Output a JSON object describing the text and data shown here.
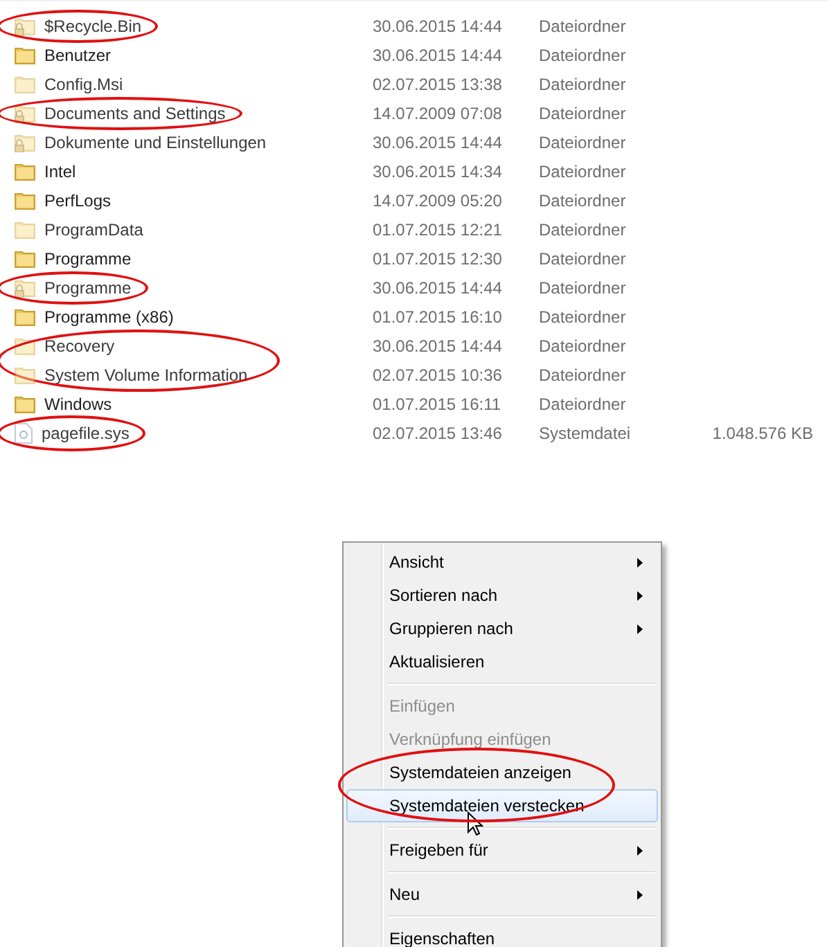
{
  "files": [
    {
      "name": "$Recycle.Bin",
      "date": "30.06.2015 14:44",
      "type": "Dateiordner",
      "kind": "folder",
      "locked": true,
      "hidden": true,
      "circled": true
    },
    {
      "name": "Benutzer",
      "date": "30.06.2015 14:44",
      "type": "Dateiordner",
      "kind": "folder",
      "locked": false,
      "hidden": false,
      "circled": false
    },
    {
      "name": "Config.Msi",
      "date": "02.07.2015 13:38",
      "type": "Dateiordner",
      "kind": "folder",
      "locked": false,
      "hidden": true,
      "circled": false
    },
    {
      "name": "Documents and Settings",
      "date": "14.07.2009 07:08",
      "type": "Dateiordner",
      "kind": "folder",
      "locked": true,
      "hidden": true,
      "circled": true
    },
    {
      "name": "Dokumente und Einstellungen",
      "date": "30.06.2015 14:44",
      "type": "Dateiordner",
      "kind": "folder",
      "locked": true,
      "hidden": true,
      "circled": false
    },
    {
      "name": "Intel",
      "date": "30.06.2015 14:34",
      "type": "Dateiordner",
      "kind": "folder",
      "locked": false,
      "hidden": false,
      "circled": false
    },
    {
      "name": "PerfLogs",
      "date": "14.07.2009 05:20",
      "type": "Dateiordner",
      "kind": "folder",
      "locked": false,
      "hidden": false,
      "circled": false
    },
    {
      "name": "ProgramData",
      "date": "01.07.2015 12:21",
      "type": "Dateiordner",
      "kind": "folder",
      "locked": false,
      "hidden": true,
      "circled": false
    },
    {
      "name": "Programme",
      "date": "01.07.2015 12:30",
      "type": "Dateiordner",
      "kind": "folder",
      "locked": false,
      "hidden": false,
      "circled": false
    },
    {
      "name": "Programme",
      "date": "30.06.2015 14:44",
      "type": "Dateiordner",
      "kind": "folder",
      "locked": true,
      "hidden": true,
      "circled": true
    },
    {
      "name": "Programme (x86)",
      "date": "01.07.2015 16:10",
      "type": "Dateiordner",
      "kind": "folder",
      "locked": false,
      "hidden": false,
      "circled": false
    },
    {
      "name": "Recovery",
      "date": "30.06.2015 14:44",
      "type": "Dateiordner",
      "kind": "folder",
      "locked": false,
      "hidden": true,
      "circled": true
    },
    {
      "name": "System Volume Information",
      "date": "02.07.2015 10:36",
      "type": "Dateiordner",
      "kind": "folder",
      "locked": false,
      "hidden": true,
      "circled": true
    },
    {
      "name": "Windows",
      "date": "01.07.2015 16:11",
      "type": "Dateiordner",
      "kind": "folder",
      "locked": false,
      "hidden": false,
      "circled": false
    },
    {
      "name": "pagefile.sys",
      "date": "02.07.2015 13:46",
      "type": "Systemdatei",
      "size": "1.048.576 KB",
      "kind": "file",
      "locked": false,
      "hidden": true,
      "circled": true
    }
  ],
  "context_menu": {
    "groups": [
      [
        {
          "label": "Ansicht",
          "submenu": true,
          "disabled": false,
          "selected": false,
          "circled": false
        },
        {
          "label": "Sortieren nach",
          "submenu": true,
          "disabled": false,
          "selected": false,
          "circled": false
        },
        {
          "label": "Gruppieren nach",
          "submenu": true,
          "disabled": false,
          "selected": false,
          "circled": false
        },
        {
          "label": "Aktualisieren",
          "submenu": false,
          "disabled": false,
          "selected": false,
          "circled": false
        }
      ],
      [
        {
          "label": "Einfügen",
          "submenu": false,
          "disabled": true,
          "selected": false,
          "circled": false
        },
        {
          "label": "Verknüpfung einfügen",
          "submenu": false,
          "disabled": true,
          "selected": false,
          "circled": false
        },
        {
          "label": "Systemdateien anzeigen",
          "submenu": false,
          "disabled": false,
          "selected": false,
          "circled": true
        },
        {
          "label": "Systemdateien verstecken",
          "submenu": false,
          "disabled": false,
          "selected": true,
          "circled": true
        }
      ],
      [
        {
          "label": "Freigeben für",
          "submenu": true,
          "disabled": false,
          "selected": false,
          "circled": false
        }
      ],
      [
        {
          "label": "Neu",
          "submenu": true,
          "disabled": false,
          "selected": false,
          "circled": false
        }
      ],
      [
        {
          "label": "Eigenschaften",
          "submenu": false,
          "disabled": false,
          "selected": false,
          "circled": false
        }
      ]
    ]
  }
}
